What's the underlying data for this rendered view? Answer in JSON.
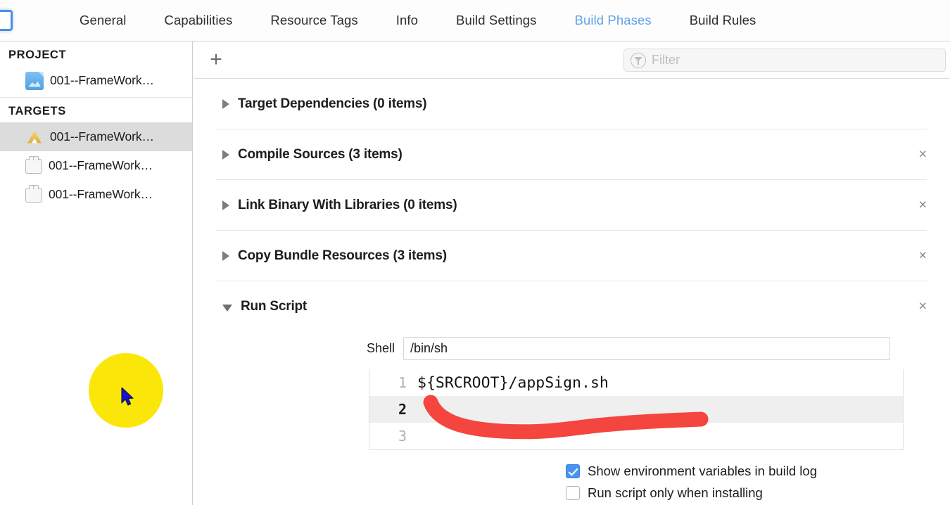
{
  "window": {
    "doc_icon": "project-document-icon"
  },
  "tabbar": {
    "tabs": [
      {
        "label": "General",
        "active": false
      },
      {
        "label": "Capabilities",
        "active": false
      },
      {
        "label": "Resource Tags",
        "active": false
      },
      {
        "label": "Info",
        "active": false
      },
      {
        "label": "Build Settings",
        "active": false
      },
      {
        "label": "Build Phases",
        "active": true
      },
      {
        "label": "Build Rules",
        "active": false
      }
    ],
    "active_color": "#62a3e8"
  },
  "sidebar": {
    "project_header": "PROJECT",
    "project_items": [
      {
        "label": "001--FrameWork…",
        "icon": "project-document-icon"
      }
    ],
    "targets_header": "TARGETS",
    "target_items": [
      {
        "label": "001--FrameWork…",
        "icon": "app-target-icon",
        "selected": true
      },
      {
        "label": "001--FrameWork…",
        "icon": "bundle-target-icon",
        "selected": false
      },
      {
        "label": "001--FrameWork…",
        "icon": "bundle-target-icon",
        "selected": false
      }
    ]
  },
  "toolbar": {
    "add_label": "+",
    "filter_placeholder": "Filter",
    "filter_value": "",
    "filter_icon": "funnel-icon"
  },
  "phases": [
    {
      "title": "Target Dependencies (0 items)",
      "expanded": false,
      "removable": false
    },
    {
      "title": "Compile Sources (3 items)",
      "expanded": false,
      "removable": true
    },
    {
      "title": "Link Binary With Libraries (0 items)",
      "expanded": false,
      "removable": true
    },
    {
      "title": "Copy Bundle Resources (3 items)",
      "expanded": false,
      "removable": true
    }
  ],
  "run_script": {
    "title": "Run Script",
    "expanded": true,
    "removable": true,
    "remove_label": "×",
    "shell_label": "Shell",
    "shell_value": "/bin/sh",
    "code_lines": [
      {
        "number": "1",
        "text": "${SRCROOT}/appSign.sh",
        "active": false
      },
      {
        "number": "2",
        "text": "",
        "active": true
      },
      {
        "number": "3",
        "text": "",
        "active": false
      }
    ],
    "options": [
      {
        "label": "Show environment variables in build log",
        "checked": true
      },
      {
        "label": "Run script only when installing",
        "checked": false
      }
    ]
  },
  "annotations": {
    "cursor_halo_color": "#fbe60a",
    "cursor_color": "#1212cf",
    "stroke_color": "#f4453f"
  }
}
